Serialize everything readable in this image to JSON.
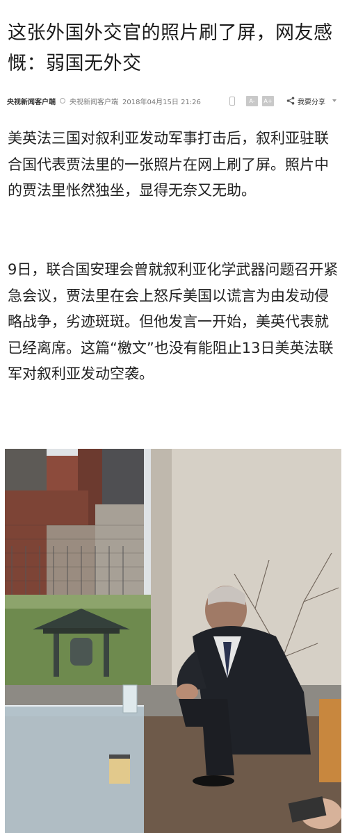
{
  "article": {
    "title": "这张外国外交官的照片刷了屏，网友感慨：弱国无外交",
    "source": "央视新闻客户端",
    "source_secondary": "央视新闻客户端",
    "datetime": "2018年04月15日 21:26",
    "font_decrease": "A-",
    "font_increase": "A+",
    "share_label": "我要分享",
    "paragraphs": [
      "美英法三国对叙利亚发动军事打击后，叙利亚驻联合国代表贾法里的一张照片在网上刷了屏。照片中的贾法里怅然独坐，显得无奈又无助。",
      "9日，联合国安理会曾就叙利亚化学武器问题召开紧急会议，贾法里在会上怒斥美国以谎言为由发动侵略战争，劣迹斑斑。但他发言一开始，美英代表就已经离席。这篇“檄文”也没有能阻止13日美英法联军对叙利亚发动空袭。"
    ]
  },
  "icons": {
    "source": "circle-icon",
    "mobile": "phone-icon",
    "share": "share-icon",
    "dropdown": "chevron-down-icon"
  }
}
